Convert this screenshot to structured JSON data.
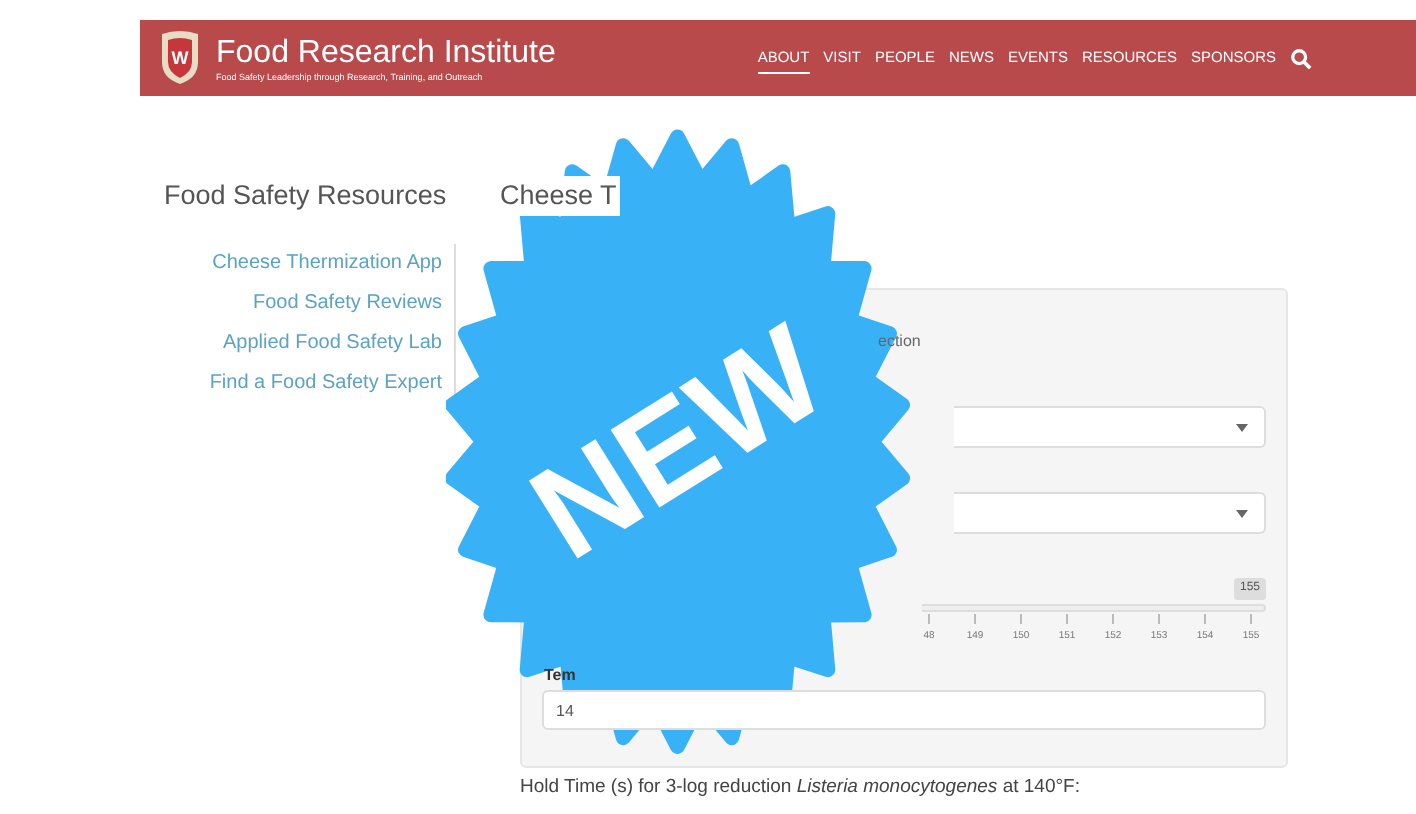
{
  "header": {
    "title": "Food Research Institute",
    "tagline": "Food Safety Leadership through Research, Training, and Outreach",
    "crest_letter": "W",
    "nav": [
      {
        "label": "ABOUT",
        "selected": true
      },
      {
        "label": "VISIT",
        "selected": false
      },
      {
        "label": "PEOPLE",
        "selected": false
      },
      {
        "label": "NEWS",
        "selected": false
      },
      {
        "label": "EVENTS",
        "selected": false
      },
      {
        "label": "RESOURCES",
        "selected": false
      },
      {
        "label": "SPONSORS",
        "selected": false
      }
    ]
  },
  "sidebar": {
    "title": "Food Safety Resources",
    "links": [
      "Cheese Thermization App",
      "Food Safety Reviews",
      "Applied Food Safety Lab",
      "Find a Food Safety Expert"
    ]
  },
  "main": {
    "title": "Cheese T",
    "field_label_fragment": "ection",
    "slider": {
      "max_label": "155",
      "tick_labels": [
        "48",
        "149",
        "150",
        "151",
        "152",
        "153",
        "154",
        "155"
      ]
    },
    "temperature_label": "Tem",
    "temperature_value": "14",
    "result": "Hold Time (s) for 3-log reduction *Listeria monocytogenes* at 140°F:"
  },
  "burst": {
    "text": "NEW"
  }
}
